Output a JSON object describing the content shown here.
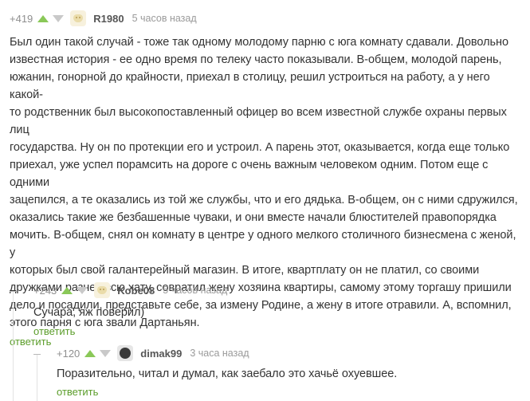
{
  "comments": [
    {
      "rating": "+419",
      "author": "R1980",
      "time": "5 часов назад",
      "text": "Был один такой случай - тоже так одному молодому парню с юга комнату сдавали. Довольно\nизвестная история - ее одно время по телеку часто показывали. В-общем, молодой парень,\nюжанин, гонорной до крайности, приехал в столицу, решил устроиться на работу, а у него какой-\nто родственник был высокопоставленный офицер во всем известной службе охраны первых лиц\nгосударства. Ну он по протекции его и устроил. А парень этот, оказывается, когда еще только\nприехал, уже успел порамсить на дороге с очень важным человеком одним. Потом еще с одними\nзацепился, а те оказались из той же службы, что и его дядька. В-общем, он с ними сдружился,\nоказались такие же безбашенные чуваки, и они вместе начали блюстителей правопорядка\nмочить. В-общем, снял он комнату в центре у одного мелкого столичного бизнесмена с женой, у\nкоторых был свой галантерейный магазин. В итоге, квартплату он не платил, со своими\nдружками разнес всю хату, совратил жену хозяина квартиры, самому этому торгашу пришили\nдело и посадили, представьте себе, за измену Родине, а жену в итоге отравили. А, вспомнил,\nэтого парня с юга звали Дартаньян.",
      "reply_label": "ответить"
    },
    {
      "rating": "+243",
      "author": "Kobe08",
      "time": "5 часов назад",
      "text": "Сучара, яж поверил)",
      "reply_label": "ответить"
    },
    {
      "rating": "+120",
      "author": "dimak99",
      "time": "3 часа назад",
      "text": "Поразительно, читал и думал, как заебало это хачьё охуевшее.",
      "reply_label": "ответить"
    }
  ],
  "colors": {
    "upvote": "#8ac858",
    "downvote": "#c9c9c9",
    "reply": "#5b9d2a"
  },
  "icons": {
    "upvote": "arrow-up-icon",
    "downvote": "arrow-down-icon",
    "collapse": "minus-icon"
  }
}
